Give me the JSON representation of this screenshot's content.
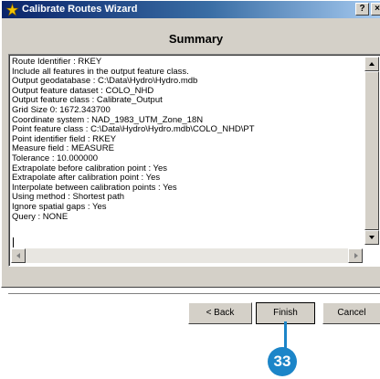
{
  "window": {
    "title": "Calibrate Routes Wizard",
    "title_icon": "wizard-star-icon",
    "help_glyph": "?",
    "close_glyph": "×"
  },
  "page": {
    "heading": "Summary"
  },
  "summary": {
    "lines": [
      "Route Identifier : RKEY",
      "Include all features in the output feature class.",
      "Output geodatabase : C:\\Data\\Hydro\\Hydro.mdb",
      "Output feature dataset : COLO_NHD",
      "Output feature class : Calibrate_Output",
      "Grid Size 0: 1672.343700",
      "Coordinate system : NAD_1983_UTM_Zone_18N",
      "Point feature class : C:\\Data\\Hydro\\Hydro.mdb\\COLO_NHD\\PT",
      "Point identifier field : RKEY",
      "Measure field : MEASURE",
      "Tolerance : 10.000000",
      "Extrapolate before calibration point : Yes",
      "Extrapolate after calibration point : Yes",
      "Interpolate between calibration points : Yes",
      "Using method : Shortest path",
      "Ignore spatial gaps : Yes",
      "Query : NONE"
    ]
  },
  "buttons": {
    "back": "< Back",
    "finish": "Finish",
    "cancel": "Cancel"
  },
  "callout": {
    "number": "33",
    "color": "#1c85c8"
  },
  "colors": {
    "dialog_face": "#d4d0c8",
    "titlebar_start": "#0a246a",
    "titlebar_end": "#a6caf0"
  }
}
